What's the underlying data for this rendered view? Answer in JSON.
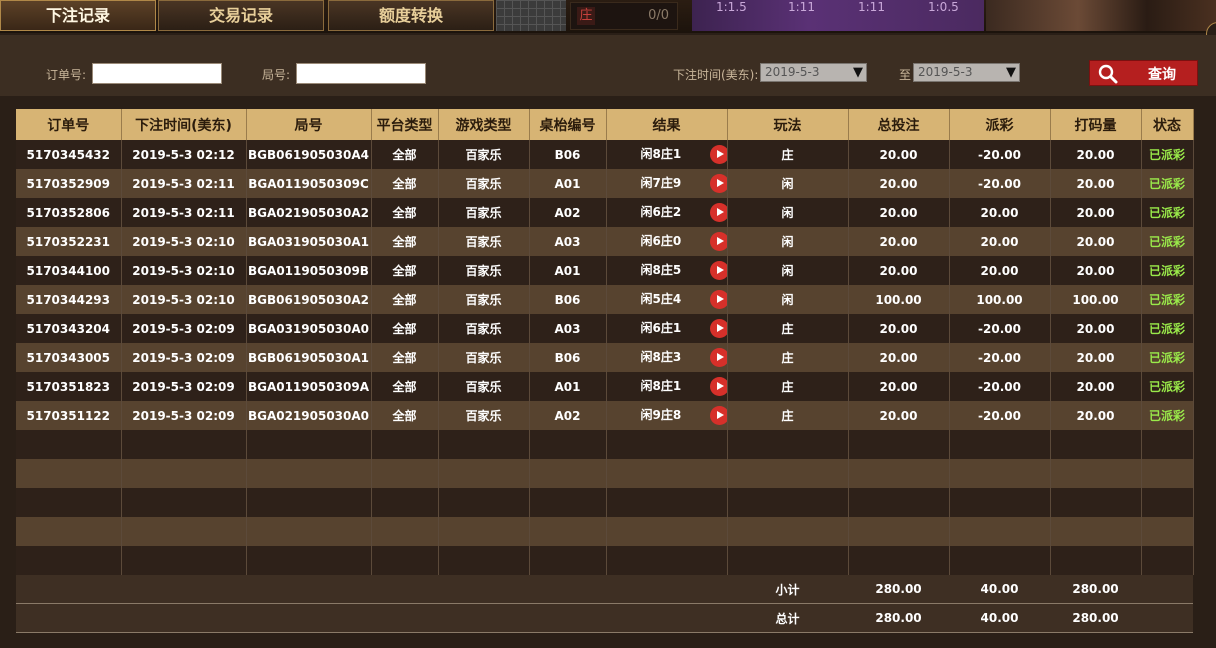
{
  "tabs": [
    {
      "label": "下注记录",
      "active": true
    },
    {
      "label": "交易记录",
      "active": false
    },
    {
      "label": "额度转换",
      "active": false
    }
  ],
  "top_score": {
    "badge": "庄",
    "value": "0/0"
  },
  "purple_scores": [
    "1:1.5",
    "1:11",
    "1:11",
    "1:0.5"
  ],
  "filters": {
    "order_label": "订单号:",
    "order_value": "",
    "round_label": "局号:",
    "round_value": "",
    "time_label": "下注时间(美东):",
    "start_date": "2019-5-3",
    "to_label": "至",
    "end_date": "2019-5-3",
    "query_label": "查询"
  },
  "table": {
    "headers": [
      "订单号",
      "下注时间(美东)",
      "局号",
      "平台类型",
      "游戏类型",
      "桌枱编号",
      "结果",
      "玩法",
      "总投注",
      "派彩",
      "打码量",
      "状态"
    ],
    "rows": [
      {
        "order": "5170345432",
        "time": "2019-5-3 02:12",
        "round": "BGB061905030A4",
        "platform": "全部",
        "game": "百家乐",
        "table": "B06",
        "result": "闲8庄1",
        "play": "庄",
        "bet": "20.00",
        "payout": "-20.00",
        "turnover": "20.00",
        "status": "已派彩"
      },
      {
        "order": "5170352909",
        "time": "2019-5-3 02:11",
        "round": "BGA0119050309C",
        "platform": "全部",
        "game": "百家乐",
        "table": "A01",
        "result": "闲7庄9",
        "play": "闲",
        "bet": "20.00",
        "payout": "-20.00",
        "turnover": "20.00",
        "status": "已派彩"
      },
      {
        "order": "5170352806",
        "time": "2019-5-3 02:11",
        "round": "BGA021905030A2",
        "platform": "全部",
        "game": "百家乐",
        "table": "A02",
        "result": "闲6庄2",
        "play": "闲",
        "bet": "20.00",
        "payout": "20.00",
        "turnover": "20.00",
        "status": "已派彩"
      },
      {
        "order": "5170352231",
        "time": "2019-5-3 02:10",
        "round": "BGA031905030A1",
        "platform": "全部",
        "game": "百家乐",
        "table": "A03",
        "result": "闲6庄0",
        "play": "闲",
        "bet": "20.00",
        "payout": "20.00",
        "turnover": "20.00",
        "status": "已派彩"
      },
      {
        "order": "5170344100",
        "time": "2019-5-3 02:10",
        "round": "BGA0119050309B",
        "platform": "全部",
        "game": "百家乐",
        "table": "A01",
        "result": "闲8庄5",
        "play": "闲",
        "bet": "20.00",
        "payout": "20.00",
        "turnover": "20.00",
        "status": "已派彩"
      },
      {
        "order": "5170344293",
        "time": "2019-5-3 02:10",
        "round": "BGB061905030A2",
        "platform": "全部",
        "game": "百家乐",
        "table": "B06",
        "result": "闲5庄4",
        "play": "闲",
        "bet": "100.00",
        "payout": "100.00",
        "turnover": "100.00",
        "status": "已派彩"
      },
      {
        "order": "5170343204",
        "time": "2019-5-3 02:09",
        "round": "BGA031905030A0",
        "platform": "全部",
        "game": "百家乐",
        "table": "A03",
        "result": "闲6庄1",
        "play": "庄",
        "bet": "20.00",
        "payout": "-20.00",
        "turnover": "20.00",
        "status": "已派彩"
      },
      {
        "order": "5170343005",
        "time": "2019-5-3 02:09",
        "round": "BGB061905030A1",
        "platform": "全部",
        "game": "百家乐",
        "table": "B06",
        "result": "闲8庄3",
        "play": "庄",
        "bet": "20.00",
        "payout": "-20.00",
        "turnover": "20.00",
        "status": "已派彩"
      },
      {
        "order": "5170351823",
        "time": "2019-5-3 02:09",
        "round": "BGA0119050309A",
        "platform": "全部",
        "game": "百家乐",
        "table": "A01",
        "result": "闲8庄1",
        "play": "庄",
        "bet": "20.00",
        "payout": "-20.00",
        "turnover": "20.00",
        "status": "已派彩"
      },
      {
        "order": "5170351122",
        "time": "2019-5-3 02:09",
        "round": "BGA021905030A0",
        "platform": "全部",
        "game": "百家乐",
        "table": "A02",
        "result": "闲9庄8",
        "play": "庄",
        "bet": "20.00",
        "payout": "-20.00",
        "turnover": "20.00",
        "status": "已派彩"
      }
    ],
    "subtotal": {
      "label": "小计",
      "bet": "280.00",
      "payout": "40.00",
      "turnover": "280.00"
    },
    "total": {
      "label": "总计",
      "bet": "280.00",
      "payout": "40.00",
      "turnover": "280.00"
    }
  },
  "colors": {
    "status": "#9aea4a",
    "header_bg": "#d7b474",
    "query_button": "#b51f1f",
    "play_icon": "#d6302a"
  }
}
